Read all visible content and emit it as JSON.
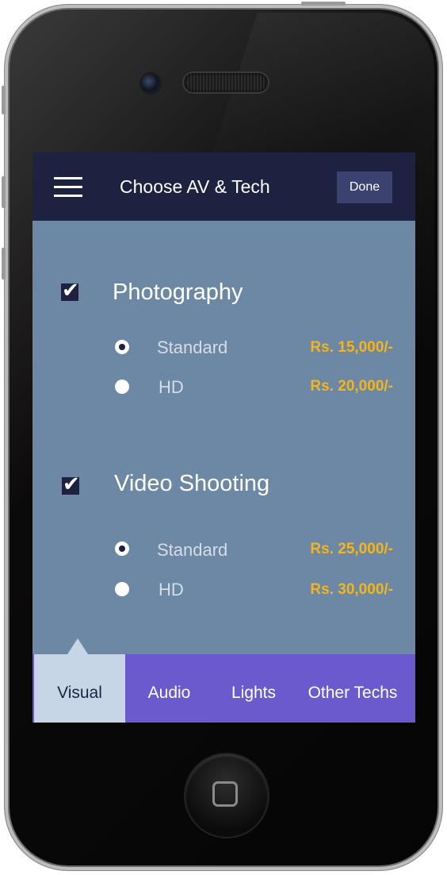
{
  "header": {
    "title": "Choose AV & Tech",
    "done_label": "Done",
    "menu_icon": "hamburger-menu-icon"
  },
  "sections": [
    {
      "title": "Photography",
      "checked": true,
      "options": [
        {
          "label": "Standard",
          "price": "Rs. 15,000/-",
          "selected": true
        },
        {
          "label": "HD",
          "price": "Rs. 20,000/-",
          "selected": false
        }
      ]
    },
    {
      "title": "Video Shooting",
      "checked": true,
      "options": [
        {
          "label": "Standard",
          "price": "Rs. 25,000/-",
          "selected": true
        },
        {
          "label": "HD",
          "price": "Rs. 30,000/-",
          "selected": false
        }
      ]
    }
  ],
  "tabs": [
    {
      "label": "Visual",
      "active": true
    },
    {
      "label": "Audio",
      "active": false
    },
    {
      "label": "Lights",
      "active": false
    },
    {
      "label": "Other Techs",
      "active": false
    }
  ],
  "colors": {
    "header": "#1e2241",
    "content_bg": "#6d88a4",
    "price": "#f3b51b",
    "tabbar": "#6a5acd",
    "active_tab": "#c7d6e6"
  }
}
